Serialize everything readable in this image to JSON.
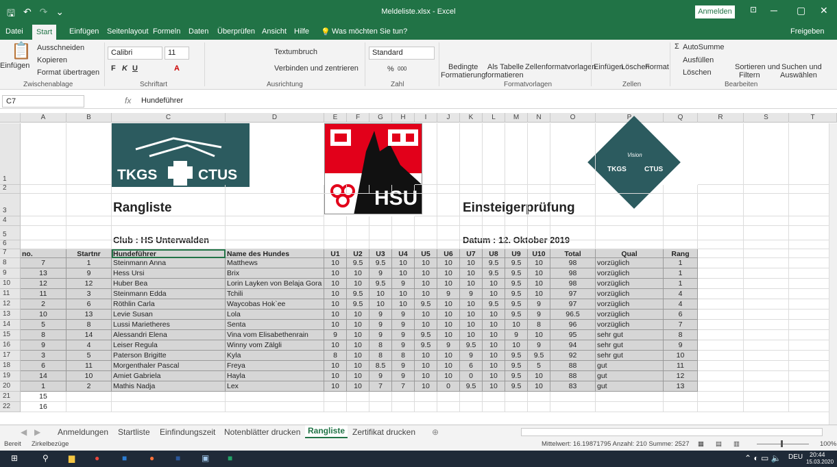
{
  "window": {
    "title": "Meldeliste.xlsx  -  Excel",
    "signin": "Anmelden",
    "minimize": "─",
    "maximize": "▢",
    "close": "✕",
    "share_icon": "⊡"
  },
  "quick": {
    "save": "🖫",
    "undo": "↶",
    "redo": "↷",
    "more": "⌄"
  },
  "tabs": [
    "Datei",
    "Start",
    "Einfügen",
    "Seitenlayout",
    "Formeln",
    "Daten",
    "Überprüfen",
    "Ansicht",
    "Hilfe",
    "Was möchten Sie tun?"
  ],
  "share": "Freigeben",
  "ribbon": {
    "paste": "Einfügen",
    "cut": "Ausschneiden",
    "copy": "Kopieren",
    "format_painter": "Format übertragen",
    "clipboard": "Zwischenablage",
    "font": "Calibri",
    "size": "11",
    "bold": "F",
    "italic": "K",
    "underline": "U",
    "font_group": "Schriftart",
    "wrap": "Textumbruch",
    "merge": "Verbinden und zentrieren",
    "align_group": "Ausrichtung",
    "numfmt": "Standard",
    "pct": "%",
    "thousand": "000",
    "num_group": "Zahl",
    "cond": "Bedingte",
    "cond2": "Formatierung",
    "as_table": "Als Tabelle",
    "as_table2": "formatieren",
    "cell_styles": "Zellenformatvorlagen",
    "styles_group": "Formatvorlagen",
    "insert": "Einfügen",
    "delete": "Löschen",
    "format": "Format",
    "cells_group": "Zellen",
    "autosum": "AutoSumme",
    "fill": "Ausfüllen",
    "clear": "Löschen",
    "sort": "Sortieren und",
    "sort2": "Filtern",
    "find": "Suchen und",
    "find2": "Auswählen",
    "edit_group": "Bearbeiten"
  },
  "formula": {
    "namebox": "C7",
    "fx": "fx",
    "value": "Hundeführer"
  },
  "columns": [
    "A",
    "B",
    "C",
    "D",
    "E",
    "F",
    "G",
    "H",
    "I",
    "J",
    "K",
    "L",
    "M",
    "N",
    "O",
    "P",
    "Q",
    "R",
    "S",
    "T"
  ],
  "rows": [
    "1",
    "2",
    "3",
    "4",
    "5",
    "6",
    "7",
    "8",
    "9",
    "10",
    "11",
    "12",
    "13",
    "14",
    "15",
    "16",
    "17",
    "18",
    "19",
    "20",
    "21",
    "22"
  ],
  "sheet": {
    "logo1": "TKGS",
    "logo1b": "CTUS",
    "logo2": "HSU",
    "logo3": "TKGS",
    "logo3b": "CTUS",
    "logo3c": "Vision",
    "title": "Rangliste",
    "title2": "Einsteigerprüfung",
    "club": "Club :  HS Unterwalden",
    "datum": "Datum : 12. Oktober 2019",
    "headers": [
      "no.",
      "Startnr",
      "Hundeführer",
      "Name des Hundes",
      "U1",
      "U2",
      "U3",
      "U4",
      "U5",
      "U6",
      "U7",
      "U8",
      "U9",
      "U10",
      "Total",
      "Qual",
      "Rang"
    ],
    "data": [
      [
        "7",
        "1",
        "Steinmann Anna",
        "Matthews",
        "10",
        "9.5",
        "9.5",
        "10",
        "10",
        "10",
        "10",
        "9.5",
        "9.5",
        "10",
        "98",
        "vorzüglich",
        "1"
      ],
      [
        "13",
        "9",
        "Hess Ursi",
        "Brix",
        "10",
        "10",
        "9",
        "10",
        "10",
        "10",
        "10",
        "9.5",
        "9.5",
        "10",
        "98",
        "vorzüglich",
        "1"
      ],
      [
        "12",
        "12",
        "Huber Bea",
        "Lorin Layken von Belaja Gora",
        "10",
        "10",
        "9.5",
        "9",
        "10",
        "10",
        "10",
        "10",
        "9.5",
        "10",
        "98",
        "vorzüglich",
        "1"
      ],
      [
        "11",
        "3",
        "Steinmann  Edda",
        "Tchili",
        "10",
        "9.5",
        "10",
        "10",
        "10",
        "9",
        "9",
        "10",
        "9.5",
        "10",
        "97",
        "vorzüglich",
        "4"
      ],
      [
        "2",
        "6",
        "Röthlin Carla",
        "Waycobas Hok`ee",
        "10",
        "9.5",
        "10",
        "10",
        "9.5",
        "10",
        "10",
        "9.5",
        "9.5",
        "9",
        "97",
        "vorzüglich",
        "4"
      ],
      [
        "10",
        "13",
        "Levie Susan",
        "Lola",
        "10",
        "10",
        "9",
        "9",
        "10",
        "10",
        "10",
        "10",
        "9.5",
        "9",
        "96.5",
        "vorzüglich",
        "6"
      ],
      [
        "5",
        "8",
        "Lussi Marietheres",
        "Senta",
        "10",
        "10",
        "9",
        "9",
        "10",
        "10",
        "10",
        "10",
        "10",
        "8",
        "96",
        "vorzüglich",
        "7"
      ],
      [
        "8",
        "14",
        "Alessandri Elena",
        "Vina vom Elisabethenrain",
        "9",
        "10",
        "9",
        "9",
        "9.5",
        "10",
        "10",
        "10",
        "9",
        "10",
        "95",
        "sehr gut",
        "8"
      ],
      [
        "9",
        "4",
        "Leiser Regula",
        "Winny vom Zälgli",
        "10",
        "10",
        "8",
        "9",
        "9.5",
        "9",
        "9.5",
        "10",
        "10",
        "9",
        "94",
        "sehr gut",
        "9"
      ],
      [
        "3",
        "5",
        "Paterson Brigitte",
        "Kyla",
        "8",
        "10",
        "8",
        "8",
        "10",
        "10",
        "9",
        "10",
        "9.5",
        "9.5",
        "92",
        "sehr gut",
        "10"
      ],
      [
        "6",
        "11",
        "Morgenthaler Pascal",
        "Freya",
        "10",
        "10",
        "8.5",
        "9",
        "10",
        "10",
        "6",
        "10",
        "9.5",
        "5",
        "88",
        "gut",
        "11"
      ],
      [
        "14",
        "10",
        "Amiet Gabriela",
        "Hayla",
        "10",
        "10",
        "9",
        "9",
        "10",
        "10",
        "0",
        "10",
        "9.5",
        "10",
        "88",
        "gut",
        "12"
      ],
      [
        "1",
        "2",
        "Mathis Nadja",
        "Lex",
        "10",
        "10",
        "7",
        "7",
        "10",
        "0",
        "9.5",
        "10",
        "9.5",
        "10",
        "83",
        "gut",
        "13"
      ]
    ],
    "row21": "15",
    "row22": "16"
  },
  "sheet_tabs": [
    "Anmeldungen",
    "Startliste",
    "Einfindungszeit",
    "Notenblätter drucken",
    "Rangliste",
    "Zertifikat drucken"
  ],
  "add_sheet": "⊕",
  "status": {
    "ready": "Bereit",
    "circ": "Zirkelbezüge",
    "stats": "Mittelwert: 16.19871795   Anzahl: 210   Summe: 2527",
    "zoom": "100%"
  },
  "taskbar": {
    "lang": "DEU",
    "time": "20:44",
    "date": "15.03.2020"
  },
  "colors": {
    "excel_green": "#217346",
    "logo_teal": "#2c5b5f",
    "shield_red": "#e2001a"
  }
}
